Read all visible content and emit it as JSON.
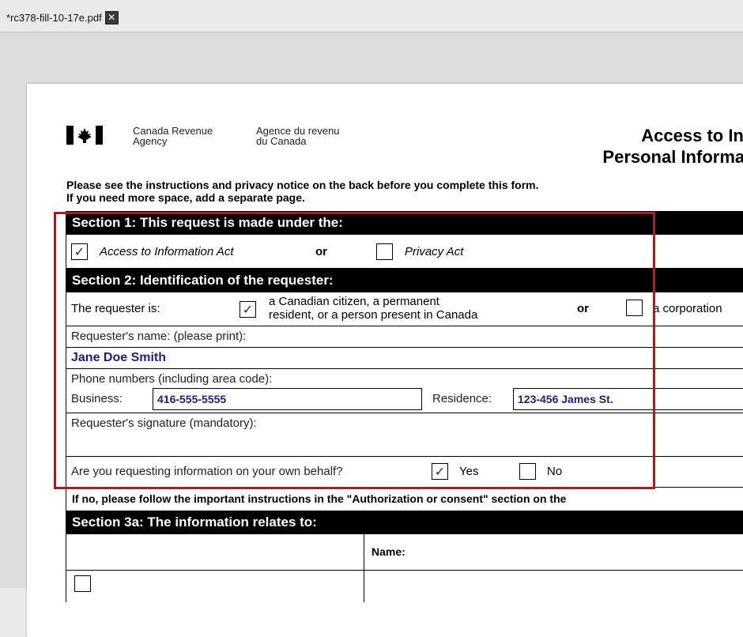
{
  "tab": {
    "title": "*rc378-fill-10-17e.pdf",
    "close_label": "✕"
  },
  "header": {
    "dept_en_line1": "Canada Revenue",
    "dept_en_line2": "Agency",
    "dept_fr_line1": "Agence du revenu",
    "dept_fr_line2": "du Canada",
    "title_line1": "Access to Informa",
    "title_line2": "Personal Information F"
  },
  "instructions": {
    "line1": "Please see the instructions and privacy notice on the back before you complete this form.",
    "line2": "If you need more space, add a separate page."
  },
  "section1": {
    "heading": "Section 1:  This request is made under the:",
    "access_label": "Access to Information Act",
    "access_checked": true,
    "or_label": "or",
    "privacy_label": "Privacy Act",
    "privacy_checked": false
  },
  "section2": {
    "heading": "Section 2: Identification of the requester:",
    "requester_is_label": "The requester is:",
    "citizen_line1": "a Canadian citizen, a permanent",
    "citizen_line2": "resident, or a person present in Canada",
    "citizen_checked": true,
    "or_label": "or",
    "corporation_label": "a corporation",
    "corporation_checked": false,
    "name_label": "Requester's name: (please print):",
    "name_value": "Jane Doe Smith",
    "phone_label": "Phone numbers (including area code):",
    "business_label": "Business:",
    "business_value": "416-555-5555",
    "residence_label": "Residence:",
    "residence_value": "123-456 James St.",
    "signature_label": "Requester's signature (mandatory):",
    "own_behalf_label": "Are you requesting information on your own behalf?",
    "yes_label": "Yes",
    "yes_checked": true,
    "no_label": "No",
    "no_checked": false,
    "note": "If no, please follow the important instructions in the \"Authorization or consent\" section on the"
  },
  "section3a": {
    "heading": "Section 3a: The information relates to:",
    "name_label": "Name:"
  },
  "colors": {
    "highlight": "#b21a1a",
    "fill_text": "#1c1c86"
  },
  "check_mark": "✓"
}
